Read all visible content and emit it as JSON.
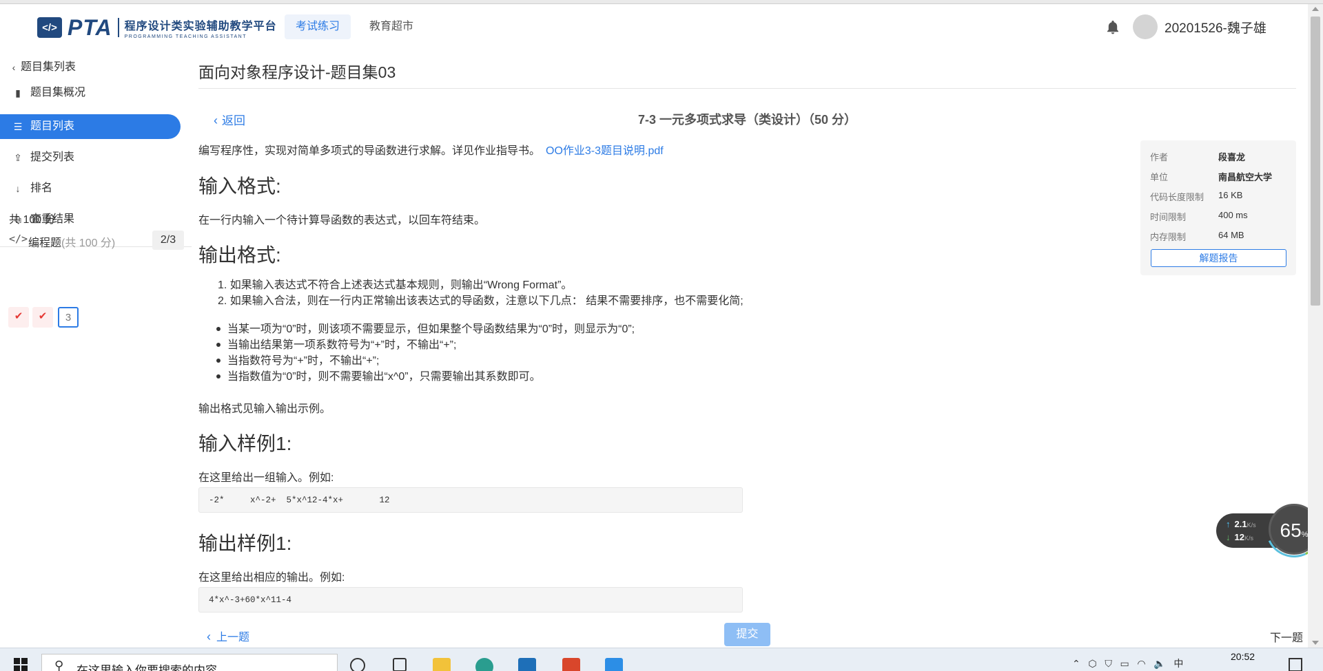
{
  "header": {
    "logo_icon": "</>",
    "logo_name": "PTA",
    "logo_cn": "程序设计类实验辅助教学平台",
    "logo_en": "PROGRAMMING TEACHING ASSISTANT",
    "tabs": [
      {
        "label": "考试练习",
        "active": true
      },
      {
        "label": "教育超市",
        "active": false
      }
    ],
    "user": "20201526-魏子雄"
  },
  "sidebar": {
    "back_label": "题目集列表",
    "items": [
      {
        "label": "题目集概况",
        "icon": "book-icon"
      },
      {
        "label": "题目列表",
        "icon": "list-icon",
        "active": true
      },
      {
        "label": "提交列表",
        "icon": "upload-icon"
      },
      {
        "label": "排名",
        "icon": "sort-icon"
      },
      {
        "label": "查重结果",
        "icon": "compare-icon"
      }
    ],
    "score_total": "共 100 分",
    "prog_label": "编程题",
    "prog_sub": "(共 100 分)",
    "prog_count": "2/3",
    "questions": [
      {
        "label": "✔",
        "status": "done"
      },
      {
        "label": "✔",
        "status": "done"
      },
      {
        "label": "3",
        "status": "current"
      }
    ]
  },
  "main": {
    "page_title": "面向对象程序设计-题目集03",
    "back_label": "返回",
    "problem_title": "7-3 一元多项式求导（类设计）（50 分）",
    "description": "编写程序性，实现对简单多项式的导函数进行求解。详见作业指导书。",
    "pdf_link": "OO作业3-3题目说明.pdf",
    "input_heading": "输入格式:",
    "input_text": "在一行内输入一个待计算导函数的表达式，以回车符结束。",
    "output_heading": "输出格式:",
    "output_rules": [
      "如果输入表达式不符合上述表达式基本规则，则输出“Wrong Format”。",
      "如果输入合法，则在一行内正常输出该表达式的导函数，注意以下几点： 结果不需要排序，也不需要化简;"
    ],
    "output_notes": [
      "当某一项为“0”时，则该项不需要显示，但如果整个导函数结果为“0”时，则显示为“0”;",
      "当输出结果第一项系数符号为“+”时，不输出“+”;",
      "当指数符号为“+”时，不输出“+”;",
      "当指数值为“0”时，则不需要输出“x^0”，只需要输出其系数即可。"
    ],
    "output_ref": "输出格式见输入输出示例。",
    "sample_in_heading": "输入样例1:",
    "sample_in_text": "在这里给出一组输入。例如:",
    "sample_in_code": "-2*     x^-2+  5*x^12-4*x+       12",
    "sample_out_heading": "输出样例1:",
    "sample_out_text": "在这里给出相应的输出。例如:",
    "sample_out_code": "4*x^-3+60*x^11-4"
  },
  "info": {
    "rows": [
      {
        "k": "作者",
        "v": "段喜龙"
      },
      {
        "k": "单位",
        "v": "南昌航空大学"
      },
      {
        "k": "代码长度限制",
        "v": "16 KB"
      },
      {
        "k": "时间限制",
        "v": "400 ms"
      },
      {
        "k": "内存限制",
        "v": "64 MB"
      }
    ],
    "report_button": "解题报告"
  },
  "speed": {
    "up": "2.1",
    "up_unit": "K/s",
    "down": "12",
    "down_unit": "K/s",
    "percent": "65",
    "percent_unit": "%"
  },
  "footer": {
    "prev": "上一题",
    "submit": "提交",
    "next": "下一题"
  },
  "taskbar": {
    "search_placeholder": "在这里输入你要搜索的内容",
    "ime": "中",
    "time": "20:52"
  },
  "colors": {
    "accent": "#2c7be5",
    "brand": "#21497f",
    "error": "#e53935"
  }
}
